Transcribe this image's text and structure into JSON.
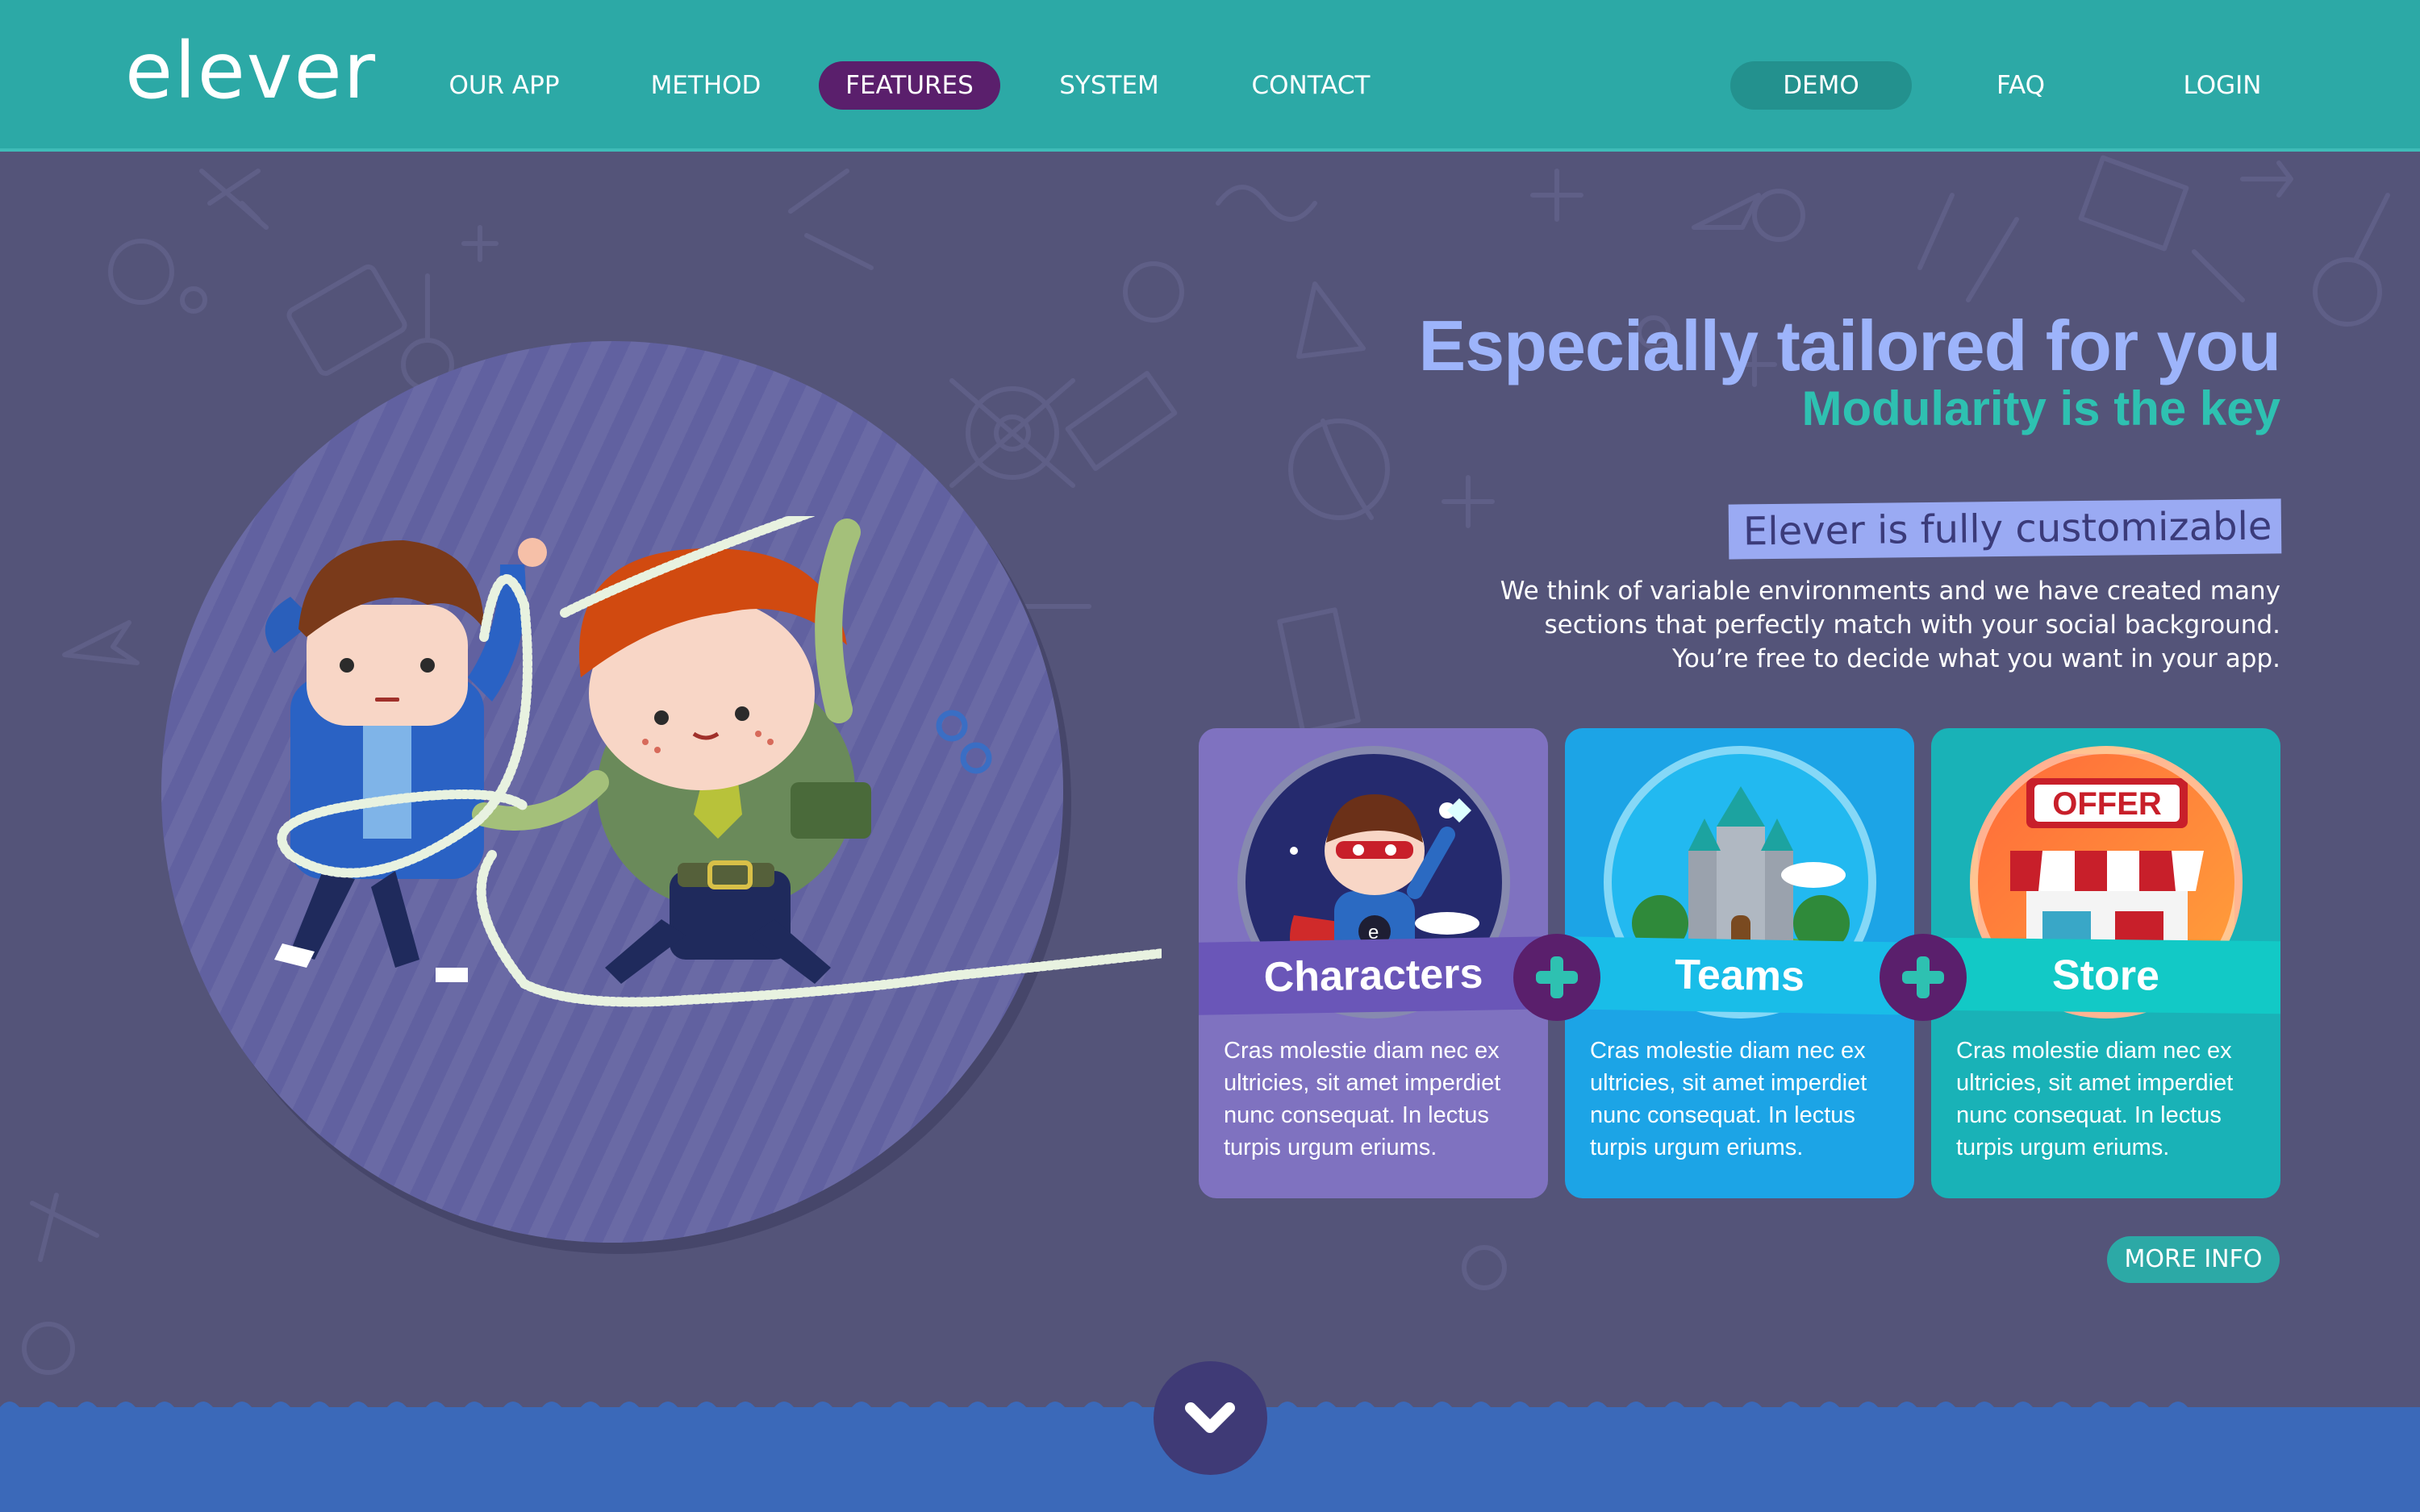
{
  "brand": {
    "logo": "elever"
  },
  "nav": {
    "items": [
      {
        "label": "OUR APP"
      },
      {
        "label": "METHOD"
      },
      {
        "label": "FEATURES",
        "active": true
      },
      {
        "label": "SYSTEM"
      },
      {
        "label": "CONTACT"
      }
    ],
    "right": [
      {
        "label": "DEMO"
      },
      {
        "label": "FAQ"
      },
      {
        "label": "LOGIN"
      }
    ]
  },
  "hero": {
    "title": "Especially tailored for you",
    "subtitle": "Modularity is the key",
    "highlight": "Elever is fully customizable",
    "description": [
      "We think of variable environments and we have created many",
      "sections that perfectly match with your social background.",
      "You’re free to decide what you want in your app."
    ]
  },
  "cards": [
    {
      "title": "Characters",
      "body": "Cras molestie diam nec ex ultricies, sit amet imperdiet nunc consequat. In lectus turpis urgum eriums.",
      "icon": "superhero-character-icon"
    },
    {
      "title": "Teams",
      "body": "Cras molestie diam nec ex ultricies, sit amet imperdiet nunc consequat. In lectus turpis urgum eriums.",
      "icon": "castle-icon"
    },
    {
      "title": "Store",
      "body": "Cras molestie diam nec ex ultricies, sit amet imperdiet nunc consequat. In lectus turpis urgum eriums.",
      "icon": "shop-icon",
      "badge": "OFFER"
    }
  ],
  "more_info": "MORE INFO",
  "colors": {
    "header": "#2ca9a6",
    "background": "#545479",
    "accent_purple": "#5a1f6c",
    "title_blue": "#9db4fb",
    "subtitle_teal": "#2ec1b1",
    "card_characters": "#7f72c0",
    "card_teams": "#1ca4e6",
    "card_store": "#19b2b7",
    "footer": "#3b69b9"
  }
}
